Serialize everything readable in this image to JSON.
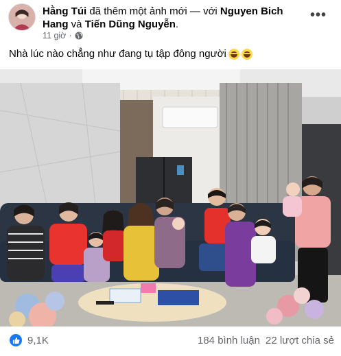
{
  "post": {
    "author": "Hằng Túi",
    "action": " đã thêm một ảnh mới — với ",
    "tagged_1": "Nguyen Bich Hang",
    "conj": " và ",
    "tagged_2": "Tiến Dũng Nguyễn",
    "period": ".",
    "time": "11 giờ",
    "dot": "·",
    "caption": "Nhà lúc nào chẳng như đang tụ tập đông người",
    "more": "•••"
  },
  "icons": {
    "avatar": "avatar",
    "privacy": "globe-icon",
    "menu": "more-icon",
    "reaction": "like-icon",
    "emoji": "grinning-sweat-emoji"
  },
  "footer": {
    "like_count": "9,1K",
    "comments": "184 bình luận",
    "shares": "22 lượt chia sẻ"
  },
  "colors": {
    "accent": "#1877f2",
    "muted": "#65676b"
  }
}
